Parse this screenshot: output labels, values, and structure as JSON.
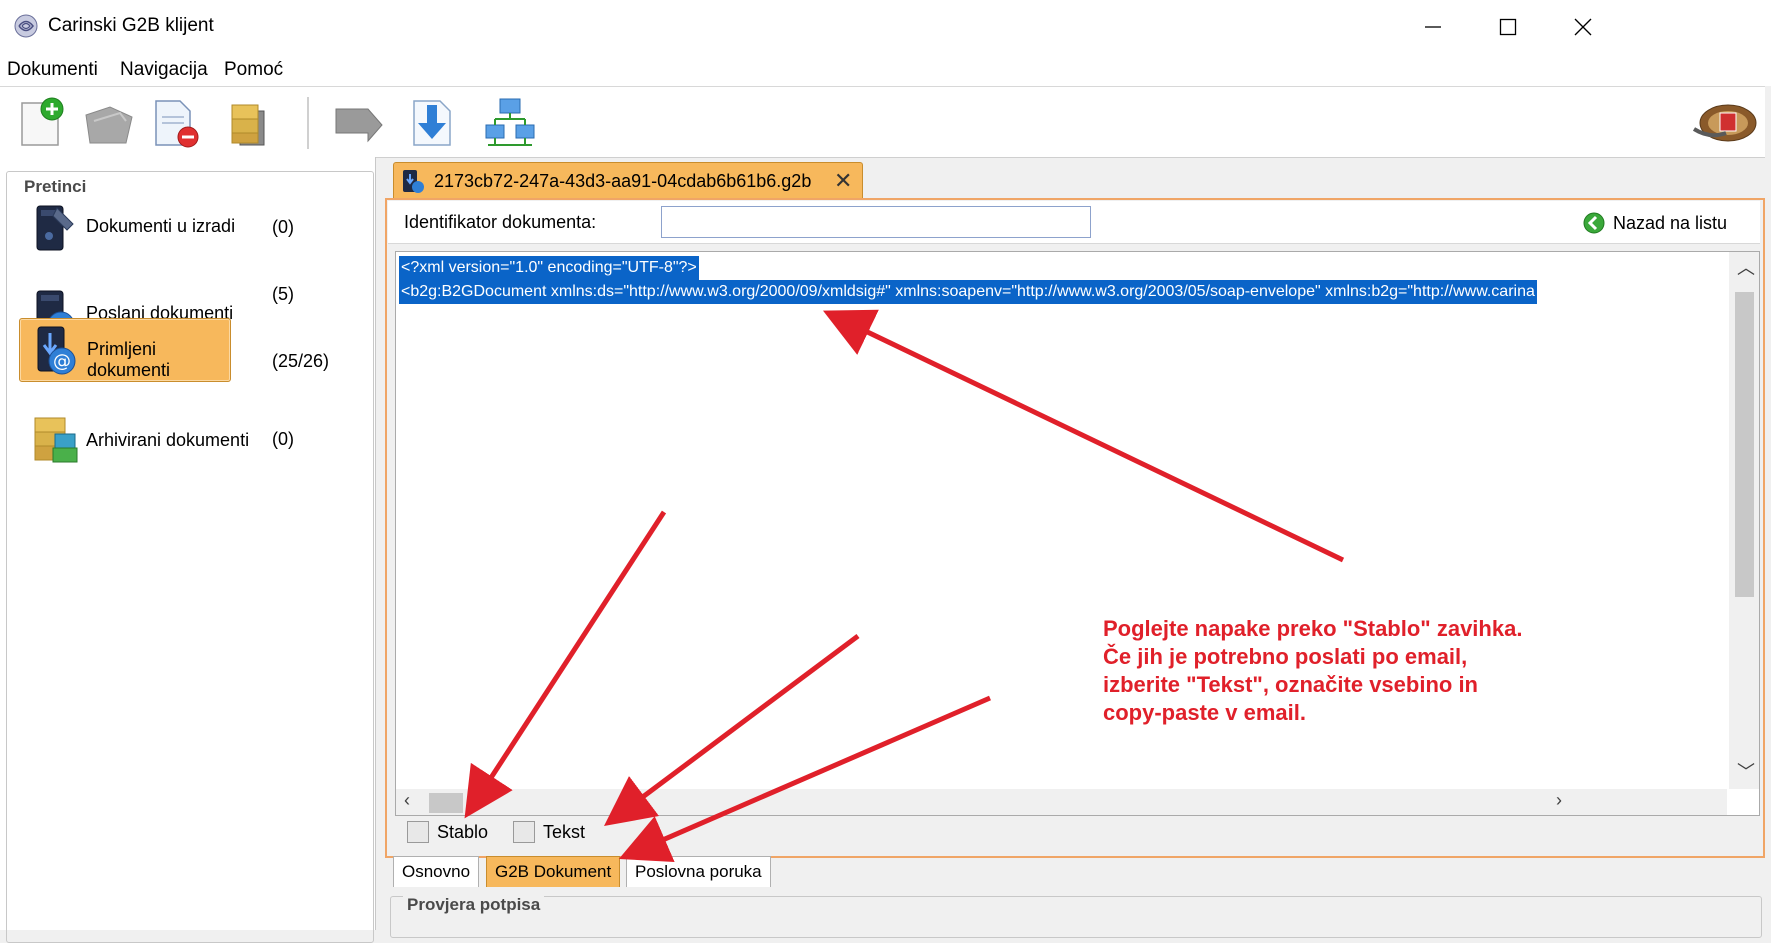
{
  "window": {
    "title": "Carinski G2B klijent",
    "minimize_label": "—",
    "maximize_label": "☐",
    "close_label": "✕"
  },
  "menu": {
    "items": [
      "Dokumenti",
      "Navigacija",
      "Pomoć"
    ]
  },
  "toolbar": {
    "buttons": [
      "new-document-icon",
      "send-icon",
      "delete-document-icon",
      "archive-icon",
      "forward-icon",
      "download-icon",
      "network-icon"
    ],
    "logo": "customs-logo"
  },
  "sidebar": {
    "title": "Pretinci",
    "items": [
      {
        "label": "Dokumenti u izradi",
        "count": "(0)"
      },
      {
        "label": "Poslani dokumenti",
        "count": "(5)"
      },
      {
        "label": "Primljeni dokumenti",
        "count": "(25/26)"
      },
      {
        "label": "Arhivirani dokumenti",
        "count": "(0)"
      }
    ],
    "selected_index": 2
  },
  "document_tab": {
    "label": "2173cb72-247a-43d3-aa91-04cdab6b61b6.g2b",
    "close_label": "✕"
  },
  "id_row": {
    "label": "Identifikator dokumenta:",
    "value": "",
    "back_label": "Nazad na listu"
  },
  "xml": {
    "line1": "<?xml version=\"1.0\" encoding=\"UTF-8\"?>",
    "line2": "<b2g:B2GDocument xmlns:ds=\"http://www.w3.org/2000/09/xmldsig#\" xmlns:soapenv=\"http://www.w3.org/2003/05/soap-envelope\" xmlns:b2g=\"http://www.carina"
  },
  "view_tabs": [
    "Stablo",
    "Tekst"
  ],
  "bottom_tabs": [
    "Osnovno",
    "G2B Dokument",
    "Poslovna poruka"
  ],
  "bottom_active": 1,
  "signature_group": "Provjera potpisa",
  "annotation": {
    "lines": [
      "Poglejte napake preko \"Stablo\" zavihka.",
      "Če jih je potrebno poslati po email,",
      "izberite \"Tekst\", označite vsebino in",
      "copy-paste v email."
    ],
    "color": "#e0202a"
  }
}
